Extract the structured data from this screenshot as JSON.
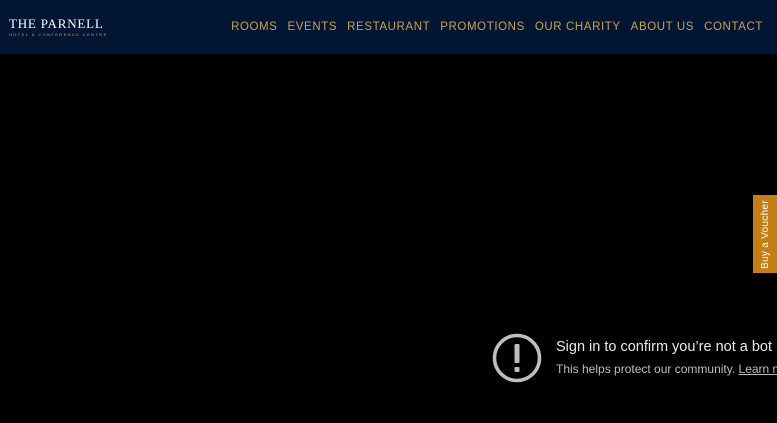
{
  "brand": {
    "name": "THE PARNELL",
    "tagline": "HOTEL & CONFERENCE CENTRE"
  },
  "nav": {
    "items": [
      {
        "label": "ROOMS"
      },
      {
        "label": "EVENTS"
      },
      {
        "label": "RESTAURANT"
      },
      {
        "label": "PROMOTIONS"
      },
      {
        "label": "OUR CHARITY"
      },
      {
        "label": "ABOUT US"
      },
      {
        "label": "CONTACT"
      }
    ]
  },
  "voucher": {
    "label": "Buy a Voucher"
  },
  "bot_notice": {
    "icon": "alert-circle-icon",
    "title": "Sign in to confirm you’re not a bot",
    "text": "This helps protect our community.",
    "link": "Learn more"
  },
  "colors": {
    "header_bg": "#021533",
    "nav_gold": "#c9a24a",
    "voucher_orange": "#c47f17",
    "video_bg": "#000000"
  }
}
